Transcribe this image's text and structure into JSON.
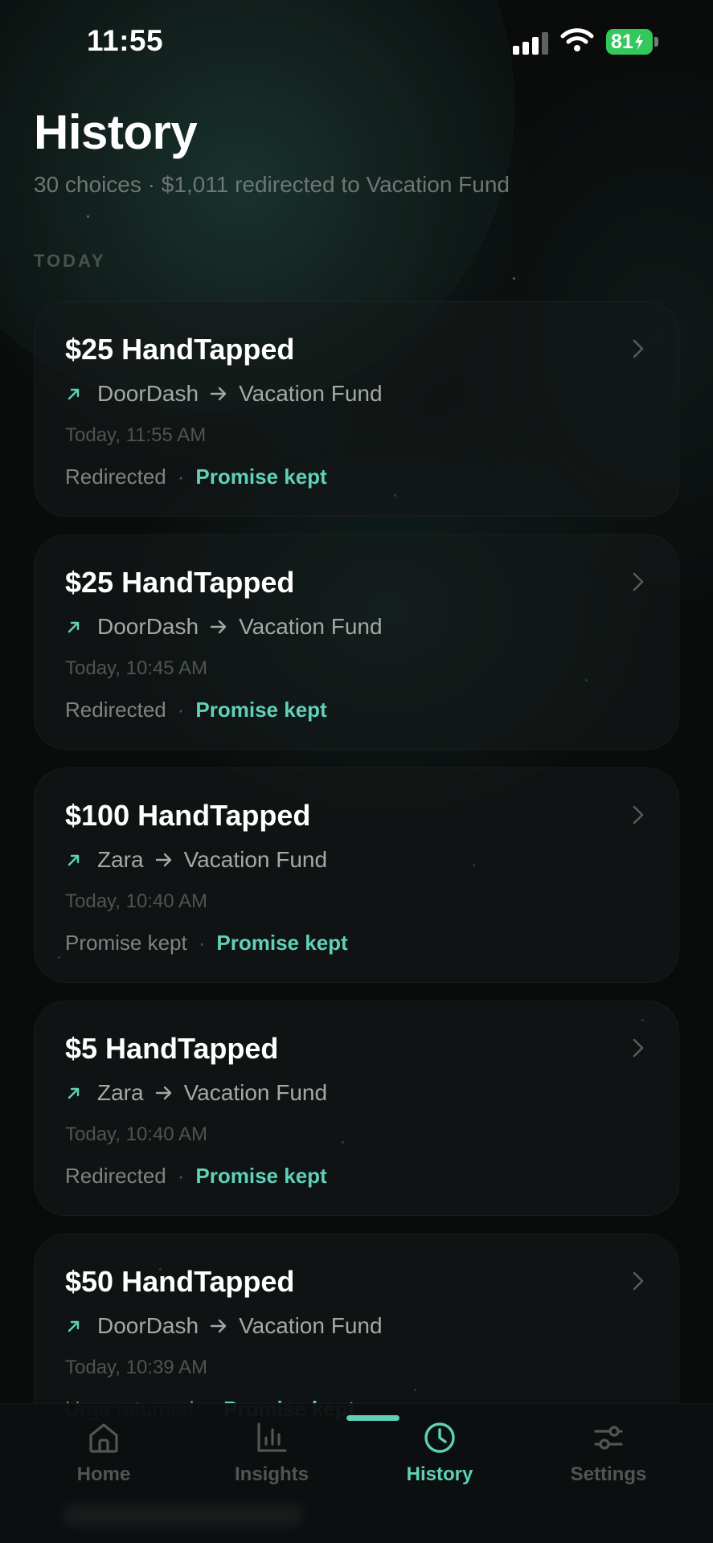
{
  "status_bar": {
    "time": "11:55",
    "battery_level": "81",
    "battery_color": "#34c759",
    "icons": [
      "cellular-signal-icon",
      "wifi-icon",
      "battery-charging-icon"
    ]
  },
  "header": {
    "title": "History",
    "subtitle": "30 choices · $1,011 redirected to Vacation Fund"
  },
  "section": {
    "label": "TODAY"
  },
  "entries": [
    {
      "title": "$25 HandTapped",
      "from": "DoorDash",
      "to": "Vacation Fund",
      "timestamp": "Today, 11:55 AM",
      "status": "Redirected",
      "outcome": "Promise kept"
    },
    {
      "title": "$25 HandTapped",
      "from": "DoorDash",
      "to": "Vacation Fund",
      "timestamp": "Today, 10:45 AM",
      "status": "Redirected",
      "outcome": "Promise kept"
    },
    {
      "title": "$100 HandTapped",
      "from": "Zara",
      "to": "Vacation Fund",
      "timestamp": "Today, 10:40 AM",
      "status": "Promise kept",
      "outcome": "Promise kept"
    },
    {
      "title": "$5 HandTapped",
      "from": "Zara",
      "to": "Vacation Fund",
      "timestamp": "Today, 10:40 AM",
      "status": "Redirected",
      "outcome": "Promise kept"
    },
    {
      "title": "$50 HandTapped",
      "from": "DoorDash",
      "to": "Vacation Fund",
      "timestamp": "Today, 10:39 AM",
      "status": "Urge returned",
      "outcome": "Promise kept"
    }
  ],
  "tab_bar": {
    "tabs": [
      {
        "label": "Home",
        "icon": "home-icon"
      },
      {
        "label": "Insights",
        "icon": "bar-chart-icon"
      },
      {
        "label": "History",
        "icon": "clock-icon",
        "active": true
      },
      {
        "label": "Settings",
        "icon": "sliders-icon"
      }
    ],
    "accent_color": "#5fd1b8"
  }
}
